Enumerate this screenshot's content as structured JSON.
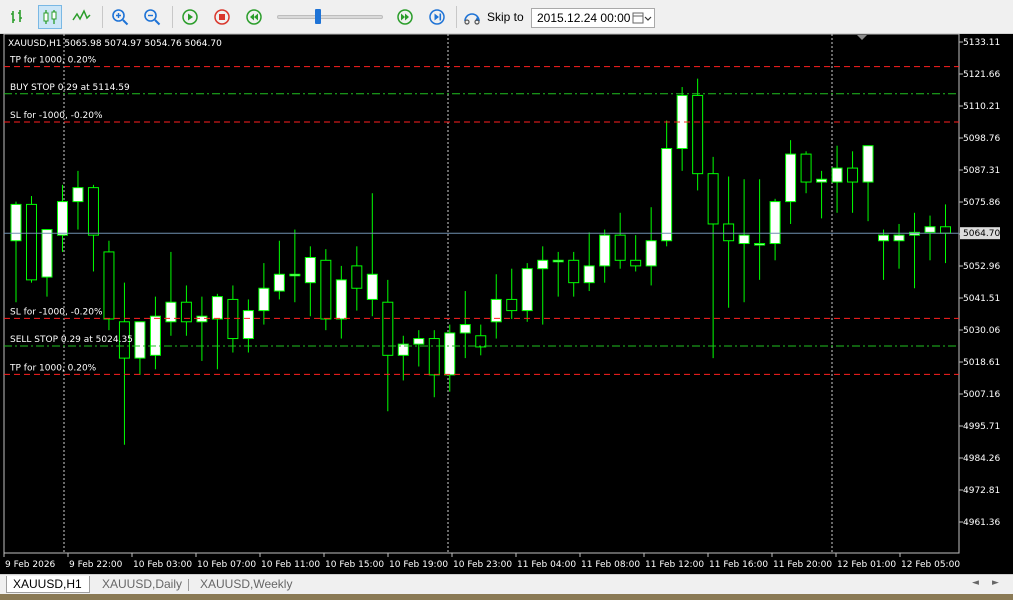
{
  "toolbar": {
    "buttons": [
      {
        "name": "bar-chart-button",
        "icon": "bar-chart-icon"
      },
      {
        "name": "candlestick-chart-button",
        "icon": "candlestick-icon",
        "active": true
      },
      {
        "name": "line-chart-button",
        "icon": "line-chart-icon"
      },
      {
        "name": "zoom-in-button",
        "icon": "zoom-in-icon"
      },
      {
        "name": "zoom-out-button",
        "icon": "zoom-out-icon"
      },
      {
        "name": "play-button",
        "icon": "play-icon"
      },
      {
        "name": "stop-button",
        "icon": "stop-icon"
      },
      {
        "name": "rewind-button",
        "icon": "rewind-icon"
      },
      {
        "name": "fast-forward-button",
        "icon": "fast-forward-icon"
      },
      {
        "name": "step-forward-button",
        "icon": "step-forward-icon"
      }
    ],
    "skip_label": "Skip to",
    "skip_date": "2015.12.24 00:00",
    "speed_slider_value": 0.38
  },
  "colors": {
    "chart_bg": "#000000",
    "bull_fill": "#ffffff",
    "wick": "#00ff00",
    "tp_sl_line": "#ff2020",
    "order_line": "#20c020",
    "price_line": "#6f8faf",
    "grid_text": "#ffffff"
  },
  "chart_data": {
    "type": "candlestick",
    "symbol_header": "XAUUSD,H1  5065.98 5074.97 5054.76 5064.70",
    "ylim": [
      4950,
      5138
    ],
    "y_ticks": [
      "5133.11",
      "5121.66",
      "5110.21",
      "5098.76",
      "5087.31",
      "5075.86",
      "5064.41",
      "5052.96",
      "5041.51",
      "5030.06",
      "5018.61",
      "5007.16",
      "4995.71",
      "4984.26",
      "4972.81",
      "4961.36"
    ],
    "x_ticks": [
      "9 Feb 2026",
      "9 Feb 22:00",
      "10 Feb 03:00",
      "10 Feb 07:00",
      "10 Feb 11:00",
      "10 Feb 15:00",
      "10 Feb 19:00",
      "10 Feb 23:00",
      "11 Feb 04:00",
      "11 Feb 08:00",
      "11 Feb 12:00",
      "11 Feb 16:00",
      "11 Feb 20:00",
      "12 Feb 01:00",
      "12 Feb 05:00"
    ],
    "current_price": "5064.70",
    "levels": [
      {
        "label": "TP for 1000, 0.20%",
        "price": 5124.3,
        "kind": "tp_sl"
      },
      {
        "label": "BUY STOP 0.29 at 5114.59",
        "price": 5114.59,
        "kind": "order"
      },
      {
        "label": "SL for -1000, -0.20%",
        "price": 5104.5,
        "kind": "tp_sl"
      },
      {
        "label": "SL for -1000, -0.20%",
        "price": 5034.2,
        "kind": "tp_sl"
      },
      {
        "label": "SELL STOP 0.29 at 5024.35",
        "price": 5024.35,
        "kind": "order"
      },
      {
        "label": "TP for 1000, 0.20%",
        "price": 5014.2,
        "kind": "tp_sl"
      }
    ],
    "day_separators": [
      "9 Feb 22:00",
      "10 Feb 23:00",
      "12 Feb 01:00"
    ],
    "candles": [
      {
        "o": 5062,
        "h": 5076,
        "l": 5040,
        "c": 5075
      },
      {
        "o": 5075,
        "h": 5078,
        "l": 5047,
        "c": 5048
      },
      {
        "o": 5049,
        "h": 5065,
        "l": 5042,
        "c": 5066
      },
      {
        "o": 5064,
        "h": 5082,
        "l": 5058,
        "c": 5076
      },
      {
        "o": 5076,
        "h": 5087,
        "l": 5066,
        "c": 5081
      },
      {
        "o": 5081,
        "h": 5082,
        "l": 5051,
        "c": 5064
      },
      {
        "o": 5058,
        "h": 5062,
        "l": 5030,
        "c": 5034
      },
      {
        "o": 5033,
        "h": 5047,
        "l": 4989,
        "c": 5020
      },
      {
        "o": 5020,
        "h": 5032,
        "l": 5014,
        "c": 5033
      },
      {
        "o": 5021,
        "h": 5042,
        "l": 5016,
        "c": 5035
      },
      {
        "o": 5033,
        "h": 5058,
        "l": 5028,
        "c": 5040
      },
      {
        "o": 5040,
        "h": 5046,
        "l": 5028,
        "c": 5033
      },
      {
        "o": 5033,
        "h": 5042,
        "l": 5019,
        "c": 5035
      },
      {
        "o": 5034,
        "h": 5043,
        "l": 5016,
        "c": 5042
      },
      {
        "o": 5041,
        "h": 5046,
        "l": 5022,
        "c": 5027
      },
      {
        "o": 5027,
        "h": 5041,
        "l": 5022,
        "c": 5037
      },
      {
        "o": 5037,
        "h": 5054,
        "l": 5032,
        "c": 5045
      },
      {
        "o": 5044,
        "h": 5062,
        "l": 5041,
        "c": 5050
      },
      {
        "o": 5050,
        "h": 5066,
        "l": 5040,
        "c": 5050
      },
      {
        "o": 5047,
        "h": 5060,
        "l": 5035,
        "c": 5056
      },
      {
        "o": 5055,
        "h": 5059,
        "l": 5030,
        "c": 5034
      },
      {
        "o": 5034,
        "h": 5053,
        "l": 5027,
        "c": 5048
      },
      {
        "o": 5053,
        "h": 5060,
        "l": 5037,
        "c": 5045
      },
      {
        "o": 5041,
        "h": 5079,
        "l": 5035,
        "c": 5050
      },
      {
        "o": 5040,
        "h": 5048,
        "l": 5001,
        "c": 5021
      },
      {
        "o": 5021,
        "h": 5028,
        "l": 5012,
        "c": 5025
      },
      {
        "o": 5025,
        "h": 5030,
        "l": 5017,
        "c": 5027
      },
      {
        "o": 5027,
        "h": 5030,
        "l": 5006,
        "c": 5014
      },
      {
        "o": 5014,
        "h": 5032,
        "l": 5008,
        "c": 5029
      },
      {
        "o": 5029,
        "h": 5044,
        "l": 5020,
        "c": 5032
      },
      {
        "o": 5028,
        "h": 5032,
        "l": 5021,
        "c": 5024
      },
      {
        "o": 5033,
        "h": 5050,
        "l": 5027,
        "c": 5041
      },
      {
        "o": 5041,
        "h": 5052,
        "l": 5034,
        "c": 5037
      },
      {
        "o": 5037,
        "h": 5054,
        "l": 5033,
        "c": 5052
      },
      {
        "o": 5052,
        "h": 5060,
        "l": 5032,
        "c": 5055
      },
      {
        "o": 5055,
        "h": 5058,
        "l": 5042,
        "c": 5055
      },
      {
        "o": 5055,
        "h": 5058,
        "l": 5042,
        "c": 5047
      },
      {
        "o": 5047,
        "h": 5065,
        "l": 5044,
        "c": 5053
      },
      {
        "o": 5053,
        "h": 5066,
        "l": 5047,
        "c": 5064
      },
      {
        "o": 5064,
        "h": 5072,
        "l": 5052,
        "c": 5055
      },
      {
        "o": 5055,
        "h": 5064,
        "l": 5051,
        "c": 5053
      },
      {
        "o": 5053,
        "h": 5074,
        "l": 5046,
        "c": 5062
      },
      {
        "o": 5062,
        "h": 5105,
        "l": 5060,
        "c": 5095
      },
      {
        "o": 5095,
        "h": 5117,
        "l": 5087,
        "c": 5114
      },
      {
        "o": 5114,
        "h": 5120,
        "l": 5080,
        "c": 5086
      },
      {
        "o": 5086,
        "h": 5092,
        "l": 5020,
        "c": 5068
      },
      {
        "o": 5068,
        "h": 5085,
        "l": 5038,
        "c": 5062
      },
      {
        "o": 5061,
        "h": 5084,
        "l": 5040,
        "c": 5064
      },
      {
        "o": 5061,
        "h": 5084,
        "l": 5048,
        "c": 5061
      },
      {
        "o": 5061,
        "h": 5077,
        "l": 5055,
        "c": 5076
      },
      {
        "o": 5076,
        "h": 5098,
        "l": 5068,
        "c": 5093
      },
      {
        "o": 5093,
        "h": 5094,
        "l": 5079,
        "c": 5083
      },
      {
        "o": 5083,
        "h": 5087,
        "l": 5070,
        "c": 5084
      },
      {
        "o": 5083,
        "h": 5096,
        "l": 5072,
        "c": 5088
      },
      {
        "o": 5088,
        "h": 5094,
        "l": 5072,
        "c": 5083
      },
      {
        "o": 5083,
        "h": 5095,
        "l": 5069,
        "c": 5096
      },
      {
        "o": 5062,
        "h": 5066,
        "l": 5048,
        "c": 5064
      },
      {
        "o": 5062,
        "h": 5068,
        "l": 5052,
        "c": 5064
      },
      {
        "o": 5064,
        "h": 5072,
        "l": 5045,
        "c": 5065
      },
      {
        "o": 5065,
        "h": 5071,
        "l": 5055,
        "c": 5067
      },
      {
        "o": 5067,
        "h": 5075,
        "l": 5054,
        "c": 5064.7
      }
    ]
  },
  "tabs": [
    {
      "label": "XAUUSD,H1",
      "active": true
    },
    {
      "label": "XAUUSD,Daily",
      "active": false
    },
    {
      "label": "XAUUSD,Weekly",
      "active": false
    }
  ]
}
